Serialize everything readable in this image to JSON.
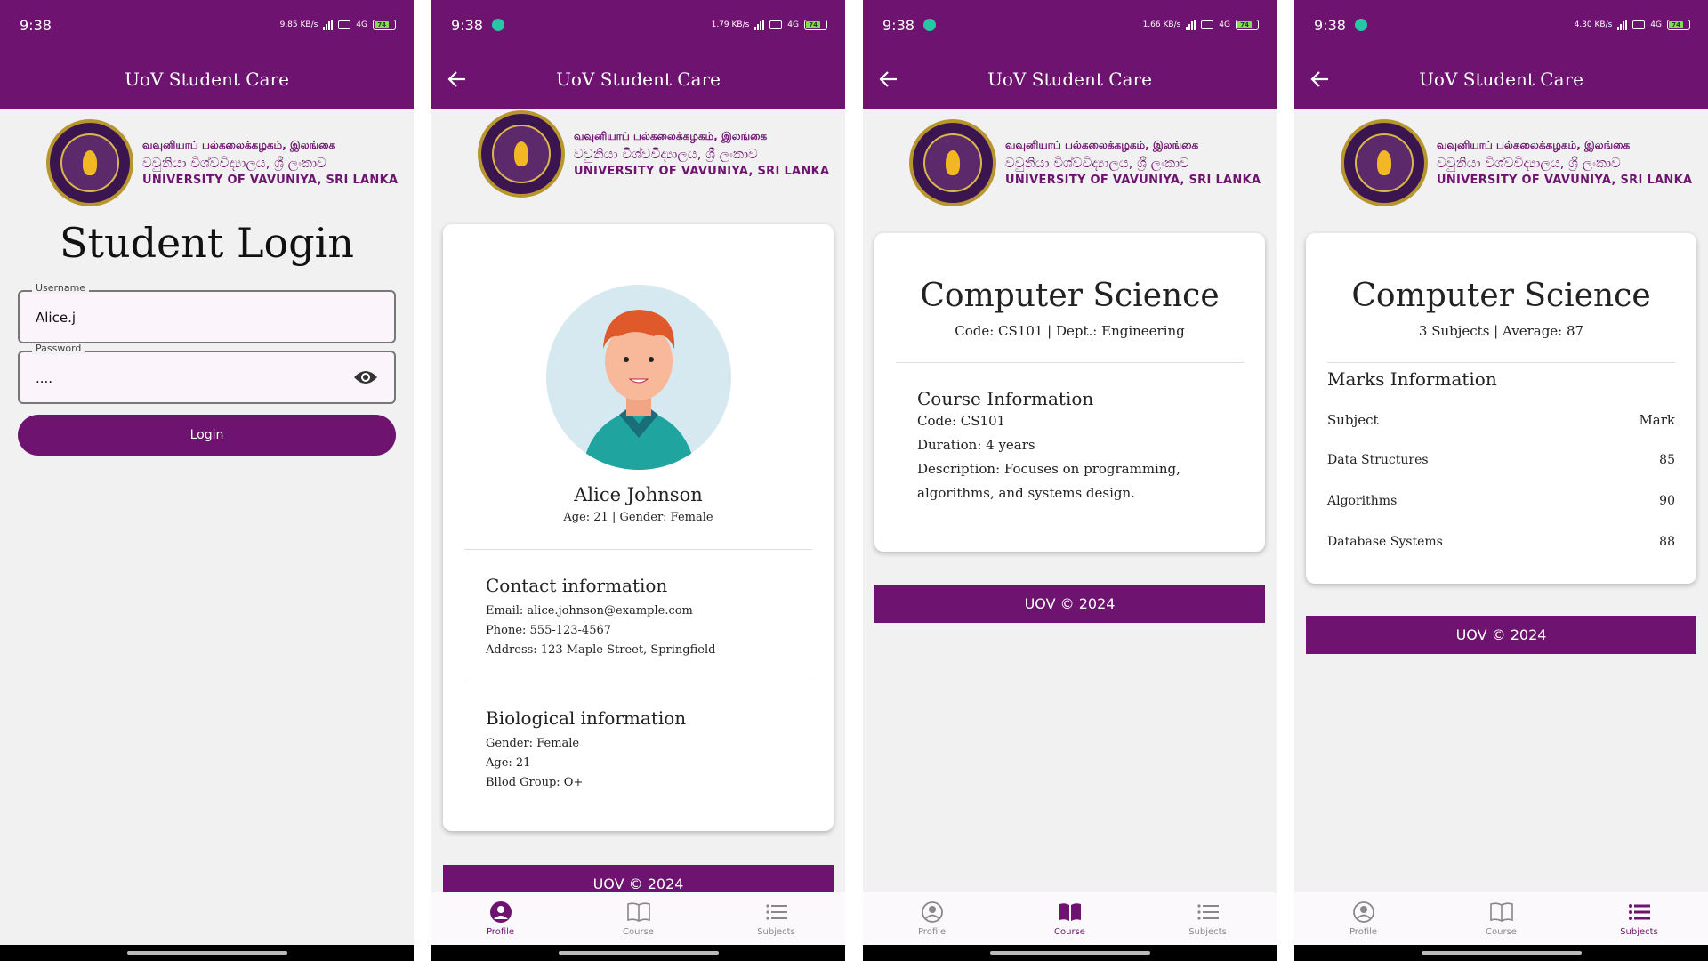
{
  "status": {
    "time": "9:38",
    "network_speeds": [
      "9.85 KB/s",
      "1.79 KB/s",
      "1.66 KB/s",
      "4.30 KB/s"
    ],
    "network_type": "4G",
    "battery_level": "74"
  },
  "app": {
    "title": "UoV Student Care",
    "primary_color": "#6e1470"
  },
  "university": {
    "name_tamil": "வவுனியாப் பல்கலைக்கழகம், இலங்கை",
    "name_sinhala": "වවුනියා විශ්වවිද්‍යාලය, ශ්‍රී ලංකාව",
    "name_english": "UNIVERSITY OF VAVUNIYA, SRI LANKA"
  },
  "login": {
    "title": "Student Login",
    "username_label": "Username",
    "username_value": "Alice.j",
    "password_label": "Password",
    "password_value": "....",
    "button": "Login"
  },
  "profile": {
    "name": "Alice Johnson",
    "summary": "Age: 21 | Gender: Female",
    "contact_heading": "Contact information",
    "email": "Email: alice.johnson@example.com",
    "phone": "Phone: 555-123-4567",
    "address": "Address: 123 Maple Street, Springfield",
    "bio_heading": "Biological information",
    "gender": "Gender: Female",
    "age": "Age: 21",
    "blood": "Bllod Group: O+"
  },
  "course": {
    "title": "Computer Science",
    "subtitle": "Code: CS101 | Dept.: Engineering",
    "info_heading": "Course Information",
    "code": "Code: CS101",
    "duration": "Duration: 4 years",
    "description_line1": "Description: Focuses on programming,",
    "description_line2": "algorithms, and systems design."
  },
  "subjects": {
    "title": "Computer Science",
    "subtitle": "3 Subjects | Average: 87",
    "heading": "Marks Information",
    "col_subject": "Subject",
    "col_mark": "Mark",
    "rows": [
      {
        "subject": "Data Structures",
        "mark": "85"
      },
      {
        "subject": "Algorithms",
        "mark": "90"
      },
      {
        "subject": "Database Systems",
        "mark": "88"
      }
    ]
  },
  "footer": "UOV © 2024",
  "nav": {
    "profile": "Profile",
    "course": "Course",
    "subjects": "Subjects"
  }
}
